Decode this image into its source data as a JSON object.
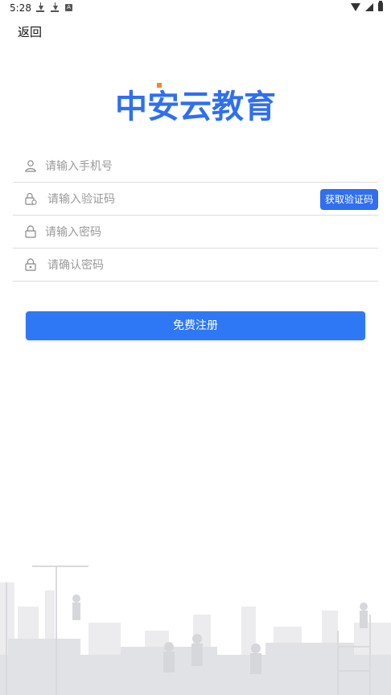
{
  "status_bar": {
    "time": "5:28",
    "left_icons": [
      "download-icon",
      "download-icon",
      "app-a-icon"
    ],
    "right_icons": [
      "wifi-icon",
      "signal-icon",
      "battery-icon"
    ]
  },
  "header": {
    "back_label": "返回"
  },
  "logo": {
    "text": "中安云教育",
    "color": "#2f6ff0",
    "accent_color": "#f08a24"
  },
  "form": {
    "phone_placeholder": "请输入手机号",
    "code_placeholder": "请输入验证码",
    "get_code_label": "获取验证码",
    "password_placeholder": "请输入密码",
    "confirm_placeholder": "请确认密码"
  },
  "actions": {
    "register_label": "免费注册"
  },
  "theme": {
    "primary": "#2f78f5",
    "background_art_color": "#e6e7ea"
  }
}
